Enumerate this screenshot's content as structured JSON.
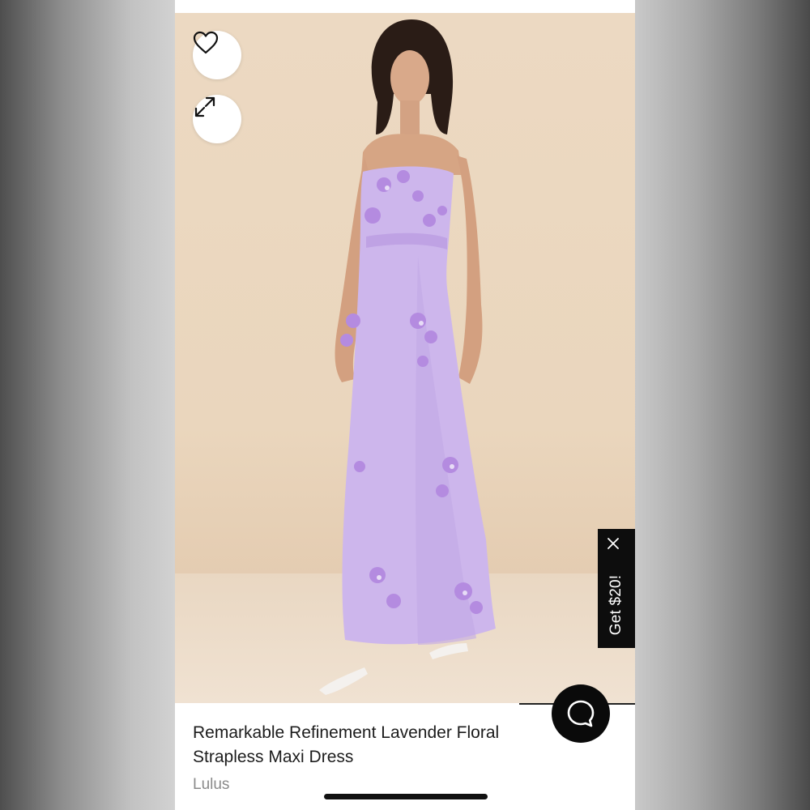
{
  "product": {
    "title": "Remarkable Refinement Lavender Floral Strapless Maxi Dress",
    "brand": "Lulus"
  },
  "actions": {
    "favorite_icon": "heart-icon",
    "expand_icon": "expand-icon",
    "chat_icon": "chat-bubble-icon"
  },
  "promo": {
    "label": "Get $20!",
    "close_icon": "close-icon"
  },
  "colors": {
    "dress": "#cdb6ec",
    "background": "#ecd9c2",
    "promo_bg": "#0d0d0d"
  }
}
